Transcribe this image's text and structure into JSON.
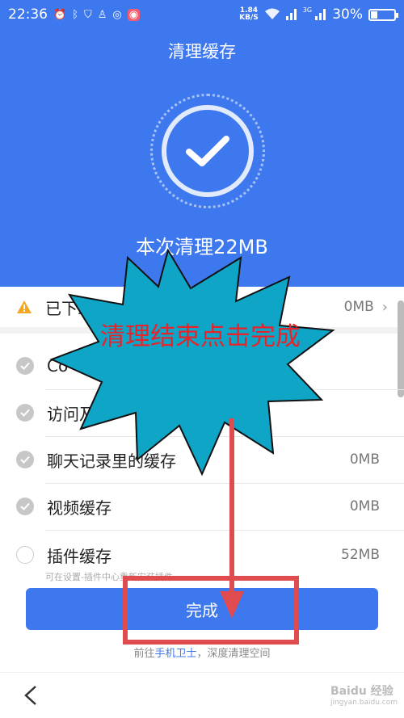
{
  "status_bar": {
    "time": "22:36",
    "net_speed": "1.84",
    "net_unit": "KB/S",
    "battery": "30%",
    "battery_level": 0.3,
    "signal_label": "3G"
  },
  "header": {
    "title": "清理缓存",
    "result": "本次清理22MB",
    "accent_color": "#3d78ee"
  },
  "warning_row": {
    "label": "已下载",
    "size": "0MB"
  },
  "items": [
    {
      "label": "Co",
      "size": "",
      "checked": true
    },
    {
      "label": "访问及",
      "size": "",
      "checked": true
    },
    {
      "label": "聊天记录里的缓存",
      "size": "0MB",
      "checked": true
    },
    {
      "label": "视频缓存",
      "size": "0MB",
      "checked": true
    },
    {
      "label": "插件缓存",
      "size": "52MB",
      "checked": false
    }
  ],
  "plugin_note": "可在设置-插件中心重新安装插件",
  "done_button": "完成",
  "footer": {
    "prefix": "前往",
    "link": "手机卫士",
    "suffix": "，深度清理空间"
  },
  "annotation": {
    "text": "清理结束点击完成",
    "text_color": "#e8232a",
    "burst_color": "#0ea5c6"
  },
  "watermark": {
    "brand": "Baidu 经验",
    "url": "jingyan.baidu.com"
  }
}
